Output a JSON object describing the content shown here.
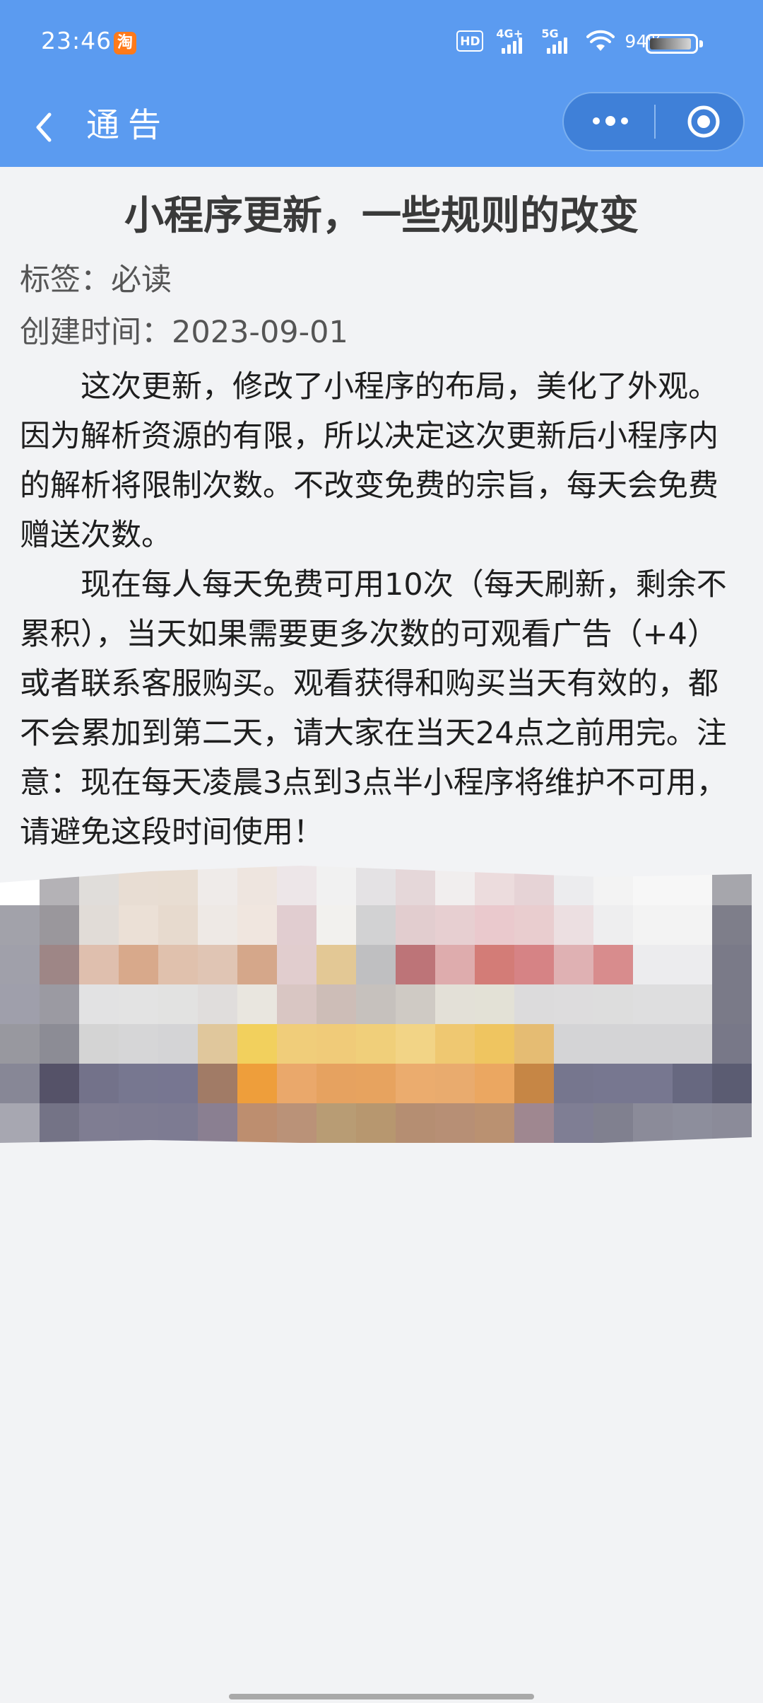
{
  "status_bar": {
    "time": "23:46",
    "app_icon": "taobao-icon",
    "app_icon_glyph": "淘",
    "hd_label": "HD",
    "network_4g_label": "4G+",
    "network_5g_label": "5G",
    "battery_percent": "94%",
    "battery_level": 0.94
  },
  "nav": {
    "title": "通告",
    "back_icon": "chevron-left-icon",
    "more_icon": "more-dots-icon",
    "close_icon": "target-icon"
  },
  "article": {
    "title": "小程序更新，一些规则的改变",
    "tag": "标签：必读",
    "created": "创建时间：2023-09-01",
    "paragraphs": [
      "这次更新，修改了小程序的布局，美化了外观。因为解析资源的有限，所以决定这次更新后小程序内的解析将限制次数。不改变免费的宗旨，每天会免费赠送次数。",
      "现在每人每天免费可用10次（每天刷新，剩余不累积），当天如果需要更多次数的可观看广告（+4）或者联系客服购买。观看获得和购买当天有效的，都不会累加到第二天，请大家在当天24点之前用完。注意：现在每天凌晨3点到3点半小程序将维护不可用，请避免这段时间使用！"
    ],
    "image_alt": "pixelated image"
  },
  "colors": {
    "header_bg": "#5b9bf0",
    "capsule_bg": "#3f80d8",
    "page_bg": "#f2f3f5",
    "mosaic": [
      [
        "#ffffff",
        "#b4b2b6",
        "#e0ddda",
        "#e8ddd3",
        "#e8ddd2",
        "#efebe9",
        "#eee5df",
        "#ede6e8",
        "#f1f1f1",
        "#e4e2e4",
        "#e5d7d9",
        "#f1eeee",
        "#ecdcdd",
        "#e6d3d6",
        "#ececee",
        "#f3f3f3",
        "#f7f7f7",
        "#f7f7f7",
        "#a6a6ac"
      ],
      [
        "#a2a2aa",
        "#9a979c",
        "#e1dcd7",
        "#ebe0d6",
        "#e7dace",
        "#eee9e5",
        "#f0e6df",
        "#e1cdd0",
        "#f2f1ee",
        "#d2d2d3",
        "#e2cdcf",
        "#e7cfd1",
        "#eac9cd",
        "#e9cdcf",
        "#ecdfe1",
        "#eeeeef",
        "#f3f3f3",
        "#f3f3f3",
        "#7e7e8a"
      ],
      [
        "#a0a0aa",
        "#9e8686",
        "#dfbfae",
        "#d8a98b",
        "#e0c1ad",
        "#e0c5b4",
        "#d5a78a",
        "#e1cdce",
        "#e3c895",
        "#bfbfc1",
        "#bd7478",
        "#deacad",
        "#d37c77",
        "#d68385",
        "#dfb1b3",
        "#d88c8d",
        "#ececee",
        "#ececee",
        "#7a7a88"
      ],
      [
        "#9f9fab",
        "#9b9aa2",
        "#e2e2e3",
        "#e3e3e3",
        "#e2e2e1",
        "#e0dddc",
        "#e9e6df",
        "#d9c6c3",
        "#cdbdb7",
        "#c6c1bd",
        "#cfcac4",
        "#e3e0d7",
        "#e3e1d6",
        "#dcdbdc",
        "#dddcdd",
        "#dddddd",
        "#dededf",
        "#dededf",
        "#7a7a88"
      ],
      [
        "#98989f",
        "#8c8c95",
        "#d4d4d4",
        "#d6d6d7",
        "#d4d4d6",
        "#e0c79c",
        "#f2d05d",
        "#f0cd7a",
        "#f0cb79",
        "#f0cf7a",
        "#f2d486",
        "#efc871",
        "#efc560",
        "#e5bc73",
        "#d4d4d6",
        "#d4d4d6",
        "#d4d4d6",
        "#d4d4d6",
        "#787888"
      ],
      [
        "#878796",
        "#555268",
        "#73728a",
        "#777790",
        "#777691",
        "#a17b66",
        "#ee9e3b",
        "#eaa86b",
        "#e6a260",
        "#e7a35f",
        "#ebac6e",
        "#e9ab6e",
        "#eba761",
        "#c68645",
        "#76768e",
        "#777790",
        "#777790",
        "#676880",
        "#5b5c72"
      ],
      [
        "#a7a7b1",
        "#747386",
        "#7f7d92",
        "#7e7c92",
        "#7d7b92",
        "#8a7f91",
        "#bd8e6f",
        "#ba9278",
        "#b89c74",
        "#b7976f",
        "#b58e72",
        "#b78f75",
        "#ba9171",
        "#9f8790",
        "#7f7e94",
        "#80808f",
        "#8b8b99",
        "#8d8e9c",
        "#8b8b99"
      ]
    ]
  }
}
